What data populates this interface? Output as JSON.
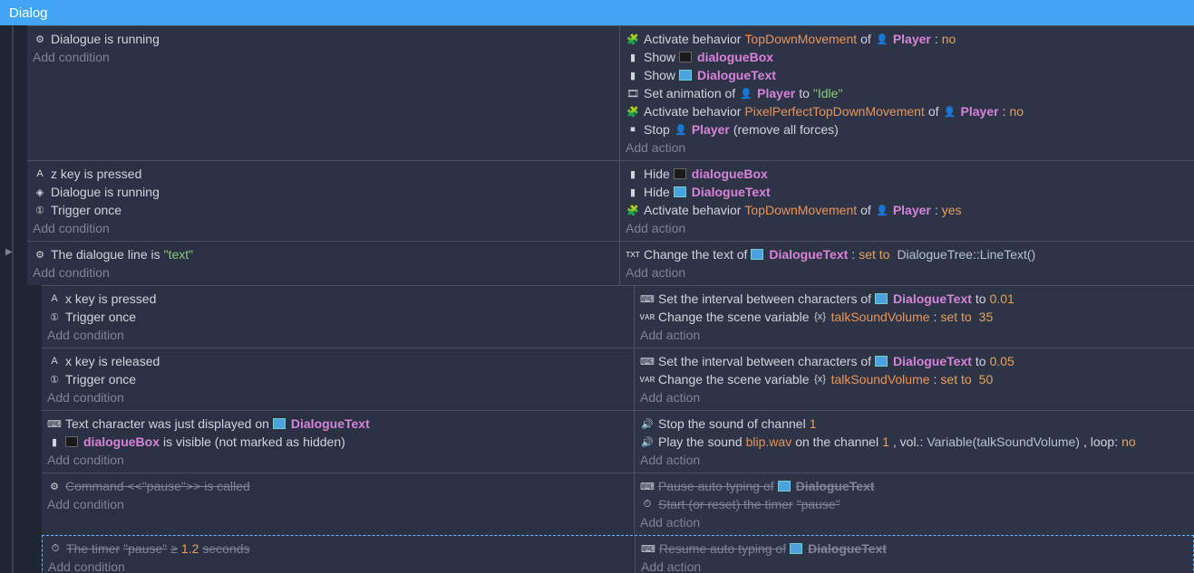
{
  "title": "Dialog",
  "add_condition": "Add condition",
  "add_action": "Add action",
  "rows": [
    {
      "conditions": [
        {
          "icon": "⚙",
          "parts": [
            {
              "t": "txt",
              "v": "Dialogue is running"
            }
          ]
        }
      ],
      "actions": [
        {
          "icon": "🧩",
          "parts": [
            {
              "t": "txt",
              "v": "Activate behavior "
            },
            {
              "t": "behav",
              "v": "TopDownMovement"
            },
            {
              "t": "txt",
              "v": " of "
            },
            {
              "t": "icon",
              "v": "👤"
            },
            {
              "t": "obj",
              "v": "Player"
            },
            {
              "t": "txt",
              "v": ": "
            },
            {
              "t": "num",
              "v": "no"
            }
          ]
        },
        {
          "icon": "📄",
          "parts": [
            {
              "t": "txt",
              "v": "Show "
            },
            {
              "t": "mini",
              "v": "dark"
            },
            {
              "t": "obj",
              "v": "dialogueBox"
            }
          ]
        },
        {
          "icon": "📄",
          "parts": [
            {
              "t": "txt",
              "v": "Show "
            },
            {
              "t": "mini",
              "v": "blue"
            },
            {
              "t": "obj",
              "v": "DialogueText"
            }
          ]
        },
        {
          "icon": "🎞",
          "parts": [
            {
              "t": "txt",
              "v": "Set animation of "
            },
            {
              "t": "icon",
              "v": "👤"
            },
            {
              "t": "obj",
              "v": "Player"
            },
            {
              "t": "txt",
              "v": " to "
            },
            {
              "t": "val",
              "v": "\"Idle\""
            }
          ]
        },
        {
          "icon": "🧩",
          "parts": [
            {
              "t": "txt",
              "v": "Activate behavior "
            },
            {
              "t": "behav",
              "v": "PixelPerfectTopDownMovement"
            },
            {
              "t": "txt",
              "v": " of "
            },
            {
              "t": "icon",
              "v": "👤"
            },
            {
              "t": "obj",
              "v": "Player"
            },
            {
              "t": "txt",
              "v": ": "
            },
            {
              "t": "num",
              "v": "no"
            }
          ]
        },
        {
          "icon": "⏹",
          "parts": [
            {
              "t": "txt",
              "v": "Stop "
            },
            {
              "t": "icon",
              "v": "👤"
            },
            {
              "t": "obj",
              "v": "Player"
            },
            {
              "t": "txt",
              "v": " (remove all forces)"
            }
          ]
        }
      ]
    },
    {
      "conditions": [
        {
          "icon": "🅰",
          "parts": [
            {
              "t": "txt",
              "v": "z key is pressed"
            }
          ]
        },
        {
          "icon": "🔶",
          "parts": [
            {
              "t": "txt",
              "v": "Dialogue is running"
            }
          ]
        },
        {
          "icon": "①",
          "parts": [
            {
              "t": "txt",
              "v": "Trigger once"
            }
          ]
        }
      ],
      "actions": [
        {
          "icon": "📄",
          "parts": [
            {
              "t": "txt",
              "v": "Hide "
            },
            {
              "t": "mini",
              "v": "dark"
            },
            {
              "t": "obj",
              "v": "dialogueBox"
            }
          ]
        },
        {
          "icon": "📄",
          "parts": [
            {
              "t": "txt",
              "v": "Hide "
            },
            {
              "t": "mini",
              "v": "blue"
            },
            {
              "t": "obj",
              "v": "DialogueText"
            }
          ]
        },
        {
          "icon": "🧩",
          "parts": [
            {
              "t": "txt",
              "v": "Activate behavior "
            },
            {
              "t": "behav",
              "v": "TopDownMovement"
            },
            {
              "t": "txt",
              "v": " of "
            },
            {
              "t": "icon",
              "v": "👤"
            },
            {
              "t": "obj",
              "v": "Player"
            },
            {
              "t": "txt",
              "v": ": "
            },
            {
              "t": "num",
              "v": "yes"
            }
          ]
        }
      ]
    },
    {
      "collapse": true,
      "conditions": [
        {
          "icon": "⚙",
          "parts": [
            {
              "t": "txt",
              "v": "The dialogue line is "
            },
            {
              "t": "val",
              "v": "\"text\""
            }
          ]
        }
      ],
      "actions": [
        {
          "icon": "txt",
          "parts": [
            {
              "t": "txt",
              "v": "Change the text of "
            },
            {
              "t": "mini",
              "v": "blue"
            },
            {
              "t": "obj",
              "v": "DialogueText"
            },
            {
              "t": "txt",
              "v": ": "
            },
            {
              "t": "num",
              "v": "set to"
            },
            {
              "t": "txt",
              "v": "  "
            },
            {
              "t": "expr",
              "v": "DialogueTree::LineText()"
            }
          ]
        }
      ]
    },
    {
      "nested": true,
      "conditions": [
        {
          "icon": "🅰",
          "parts": [
            {
              "t": "txt",
              "v": "x key is pressed"
            }
          ]
        },
        {
          "icon": "①",
          "parts": [
            {
              "t": "txt",
              "v": "Trigger once"
            }
          ]
        }
      ],
      "actions": [
        {
          "icon": "⌨",
          "parts": [
            {
              "t": "txt",
              "v": "Set the interval between characters of "
            },
            {
              "t": "mini",
              "v": "blue"
            },
            {
              "t": "obj",
              "v": "DialogueText"
            },
            {
              "t": "txt",
              "v": " to "
            },
            {
              "t": "num",
              "v": "0.01"
            }
          ]
        },
        {
          "icon": "VAR",
          "parts": [
            {
              "t": "txt",
              "v": "Change the scene variable "
            },
            {
              "t": "icon",
              "v": "{x}"
            },
            {
              "t": "behav",
              "v": "talkSoundVolume"
            },
            {
              "t": "txt",
              "v": ": "
            },
            {
              "t": "num",
              "v": "set to"
            },
            {
              "t": "txt",
              "v": "  "
            },
            {
              "t": "num",
              "v": "35"
            }
          ]
        }
      ]
    },
    {
      "nested": true,
      "conditions": [
        {
          "icon": "🅰",
          "parts": [
            {
              "t": "txt",
              "v": "x key is released"
            }
          ]
        },
        {
          "icon": "①",
          "parts": [
            {
              "t": "txt",
              "v": "Trigger once"
            }
          ]
        }
      ],
      "actions": [
        {
          "icon": "⌨",
          "parts": [
            {
              "t": "txt",
              "v": "Set the interval between characters of "
            },
            {
              "t": "mini",
              "v": "blue"
            },
            {
              "t": "obj",
              "v": "DialogueText"
            },
            {
              "t": "txt",
              "v": " to "
            },
            {
              "t": "num",
              "v": "0.05"
            }
          ]
        },
        {
          "icon": "VAR",
          "parts": [
            {
              "t": "txt",
              "v": "Change the scene variable "
            },
            {
              "t": "icon",
              "v": "{x}"
            },
            {
              "t": "behav",
              "v": "talkSoundVolume"
            },
            {
              "t": "txt",
              "v": ": "
            },
            {
              "t": "num",
              "v": "set to"
            },
            {
              "t": "txt",
              "v": "  "
            },
            {
              "t": "num",
              "v": "50"
            }
          ]
        }
      ]
    },
    {
      "nested": true,
      "conditions": [
        {
          "icon": "⌨",
          "parts": [
            {
              "t": "txt",
              "v": "Text character was just displayed on "
            },
            {
              "t": "mini",
              "v": "blue"
            },
            {
              "t": "obj",
              "v": "DialogueText"
            }
          ]
        },
        {
          "icon": "📄",
          "parts": [
            {
              "t": "mini",
              "v": "dark"
            },
            {
              "t": "obj",
              "v": "dialogueBox"
            },
            {
              "t": "txt",
              "v": " is visible (not marked as hidden)"
            }
          ]
        }
      ],
      "actions": [
        {
          "icon": "🔊",
          "parts": [
            {
              "t": "txt",
              "v": "Stop the sound of channel "
            },
            {
              "t": "num",
              "v": "1"
            }
          ]
        },
        {
          "icon": "🔊",
          "parts": [
            {
              "t": "txt",
              "v": "Play the sound "
            },
            {
              "t": "behav",
              "v": "blip.wav"
            },
            {
              "t": "txt",
              "v": " on the channel "
            },
            {
              "t": "num",
              "v": "1"
            },
            {
              "t": "txt",
              "v": ", vol.: "
            },
            {
              "t": "expr",
              "v": "Variable(talkSoundVolume)"
            },
            {
              "t": "txt",
              "v": ", loop: "
            },
            {
              "t": "num",
              "v": "no"
            }
          ]
        }
      ]
    },
    {
      "nested": true,
      "conditions": [
        {
          "icon": "⚙",
          "strike": true,
          "parts": [
            {
              "t": "txt",
              "v": "Command <<\"pause\">> is called"
            }
          ]
        }
      ],
      "actions": [
        {
          "icon": "⌨",
          "strike": true,
          "parts": [
            {
              "t": "txt",
              "v": "Pause auto typing of "
            },
            {
              "t": "mini",
              "v": "blue"
            },
            {
              "t": "obj",
              "v": "DialogueText"
            }
          ]
        },
        {
          "icon": "⏱",
          "strike": true,
          "parts": [
            {
              "t": "txt",
              "v": "Start (or reset) the timer "
            },
            {
              "t": "val",
              "v": "\"pause\""
            }
          ]
        }
      ]
    },
    {
      "nested": true,
      "selected": true,
      "conditions": [
        {
          "icon": "⏱",
          "strike": true,
          "parts": [
            {
              "t": "txt",
              "v": "The timer "
            },
            {
              "t": "val",
              "v": "\"pause\""
            },
            {
              "t": "txt",
              "v": " ≥ "
            },
            {
              "t": "num",
              "v": "1.2"
            },
            {
              "t": "txt",
              "v": " seconds"
            }
          ]
        }
      ],
      "actions": [
        {
          "icon": "⌨",
          "strike": true,
          "parts": [
            {
              "t": "txt",
              "v": "Resume auto typing of "
            },
            {
              "t": "mini",
              "v": "blue"
            },
            {
              "t": "obj",
              "v": "DialogueText"
            }
          ]
        }
      ]
    }
  ]
}
